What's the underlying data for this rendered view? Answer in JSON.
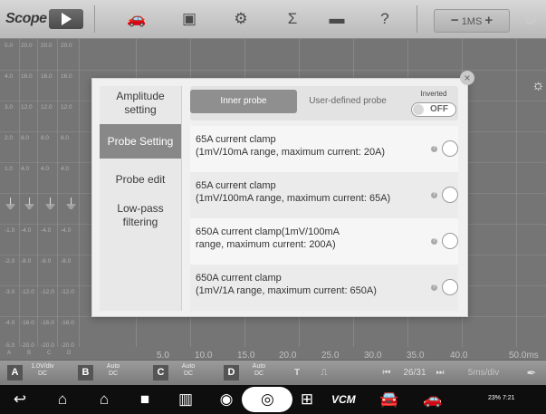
{
  "app": {
    "title": "Scope"
  },
  "toolbar": {
    "icons": [
      "play-icon",
      "car-icon",
      "chart-icon",
      "gear-icon",
      "sigma-icon",
      "folder-icon",
      "help-icon"
    ],
    "timebase": "1MS",
    "minus": "−",
    "plus": "+"
  },
  "scope": {
    "y_labels": [
      [
        "5.0",
        "20.0",
        "20.0",
        "20.0"
      ],
      [
        "4.0",
        "16.0",
        "16.0",
        "16.0"
      ],
      [
        "3.0",
        "12.0",
        "12.0",
        "12.0"
      ],
      [
        "2.0",
        "8.0",
        "8.0",
        "8.0"
      ],
      [
        "1.0",
        "4.0",
        "4.0",
        "4.0"
      ],
      [
        "-1.0",
        "-4.0",
        "-4.0",
        "-4.0"
      ],
      [
        "-2.0",
        "-8.0",
        "-8.0",
        "-8.0"
      ],
      [
        "-3.0",
        "-12.0",
        "-12.0",
        "-12.0"
      ],
      [
        "-4.0",
        "-16.0",
        "-16.0",
        "-16.0"
      ],
      [
        "-5.0",
        "-20.0",
        "-20.0",
        "-20.0"
      ]
    ],
    "x_labels": [
      "5.0",
      "10.0",
      "15.0",
      "20.0",
      "25.0",
      "30.0",
      "35.0",
      "40.0",
      "50.0ms"
    ],
    "channel_letters": [
      "A",
      "B",
      "C",
      "D"
    ]
  },
  "channel_bar": {
    "a": {
      "letter": "A",
      "scale": "1.0V/div",
      "coupling": "DC"
    },
    "b": {
      "letter": "B",
      "scale": "Auto",
      "coupling": "DC"
    },
    "c": {
      "letter": "C",
      "scale": "Auto",
      "coupling": "DC"
    },
    "d": {
      "letter": "D",
      "scale": "Auto",
      "coupling": "DC"
    },
    "trigger": "T",
    "page": "26/31",
    "speed": "5ms/div"
  },
  "dialog": {
    "tabs": [
      "Amplitude setting",
      "Probe Setting",
      "Probe edit",
      "Low-pass filtering"
    ],
    "active_tab": 1,
    "segments": [
      "Inner probe",
      "User-defined probe"
    ],
    "inverted_label": "Inverted",
    "toggle": "OFF",
    "probes": [
      "65A current clamp\n(1mV/10mA range, maximum current: 20A)",
      "65A current clamp\n(1mV/100mA range, maximum current: 65A)",
      "650A current clamp(1mV/100mA\nrange, maximum current: 200A)",
      "650A current clamp\n(1mV/1A range, maximum current: 650A)"
    ]
  },
  "nav": {
    "camera": "camera-icon",
    "status": "23% 7:21"
  },
  "colors": {
    "toolbar": "#c4c4c4",
    "grid": "#8a8a8a",
    "modal": "#f0f0f0",
    "active_tab": "#888888",
    "nav": "#0e0e0e"
  }
}
